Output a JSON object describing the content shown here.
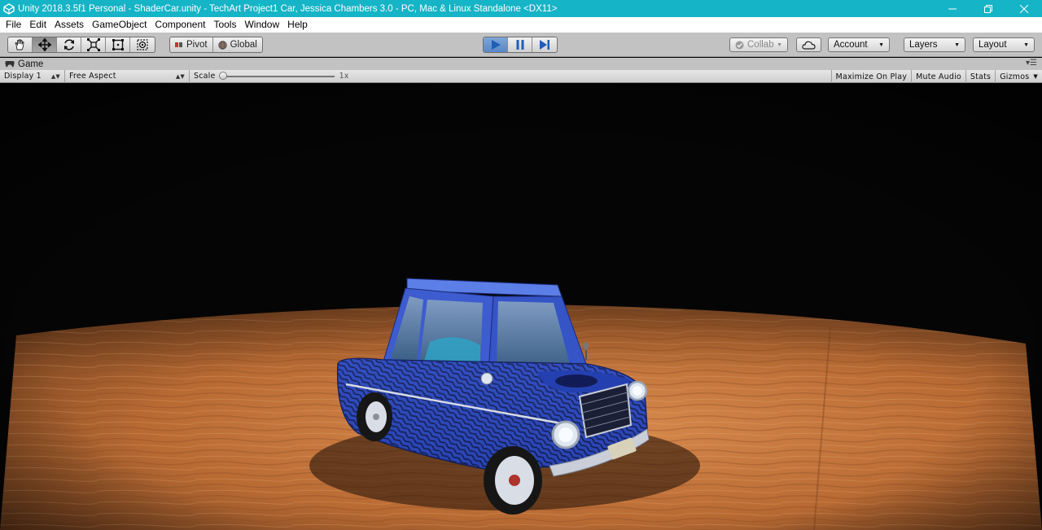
{
  "window": {
    "title": "Unity 2018.3.5f1 Personal - ShaderCar.unity - TechArt Project1 Car, Jessica Chambers 3.0 - PC, Mac & Linux Standalone <DX11>",
    "titlebar_color": "#15b4c6"
  },
  "menu": {
    "items": [
      "File",
      "Edit",
      "Assets",
      "GameObject",
      "Component",
      "Tools",
      "Window",
      "Help"
    ]
  },
  "toolbar": {
    "tools": [
      "hand-tool-icon",
      "move-tool-icon",
      "rotate-tool-icon",
      "scale-tool-icon",
      "rect-tool-icon",
      "transform-tool-icon"
    ],
    "pivot_label": "Pivot",
    "global_label": "Global",
    "collab_label": "Collab",
    "account_label": "Account",
    "layers_label": "Layers",
    "layout_label": "Layout",
    "play_state": "playing",
    "accent_color": "#3a7bd5"
  },
  "game_view": {
    "tab_label": "Game",
    "display_label": "Display 1",
    "aspect_label": "Free Aspect",
    "scale_label": "Scale",
    "scale_value": "1x",
    "maximize_label": "Maximize On Play",
    "mute_label": "Mute Audio",
    "stats_label": "Stats",
    "gizmos_label": "Gizmos"
  }
}
